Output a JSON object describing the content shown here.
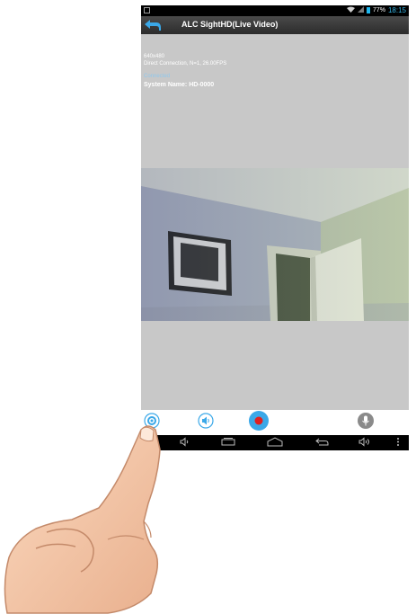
{
  "status_bar": {
    "battery": "77%",
    "time": "18:15",
    "icons": [
      "notification-icon",
      "wifi-icon",
      "signal-icon",
      "battery-icon"
    ]
  },
  "action_bar": {
    "back_icon": "back-arrow-icon",
    "title": "ALC SightHD(Live Video)"
  },
  "stream_info": {
    "resolution": "640x480",
    "connection": "Direct Connection, N=1, 26.00FPS",
    "status": "Connected",
    "system_name": "System Name: HD-0000"
  },
  "controls": [
    {
      "icon": "settings-icon",
      "color": "#3aa8e8"
    },
    {
      "icon": "speaker-icon",
      "color": "#3aa8e8"
    },
    {
      "icon": "record-icon",
      "color": "#e02020"
    },
    {
      "icon": "microphone-icon",
      "color": "#8a8a8a"
    }
  ],
  "nav_bar": [
    "volume-down-icon",
    "recent-apps-icon",
    "home-icon",
    "back-icon",
    "volume-up-icon",
    "menu-icon"
  ],
  "colors": {
    "accent": "#3aa8e8",
    "record": "#e02020",
    "background": "#c8c8c8"
  }
}
